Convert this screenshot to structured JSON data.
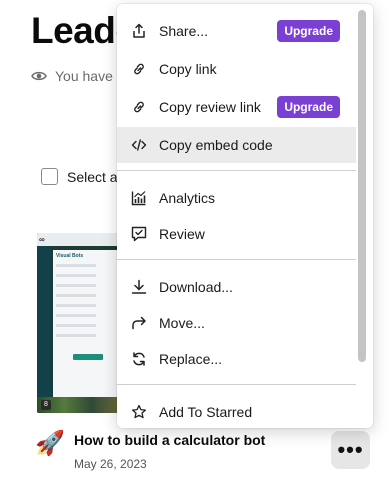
{
  "page": {
    "title": "Leado",
    "visibility_text": "You have a",
    "select_all_label": "Select a"
  },
  "card": {
    "title": "How to build a calculator bot",
    "date": "May 26, 2023",
    "emoji": "🚀",
    "more_label": "•••",
    "thumbnail": {
      "panel_title": "Visual Bots",
      "badge": "8"
    }
  },
  "menu": {
    "items": [
      {
        "label": "Share...",
        "icon": "share-icon",
        "upgrade": "Upgrade"
      },
      {
        "label": "Copy link",
        "icon": "link-icon"
      },
      {
        "label": "Copy review link",
        "icon": "link-icon",
        "upgrade": "Upgrade"
      },
      {
        "label": "Copy embed code",
        "icon": "code-icon",
        "active": true
      },
      {
        "label": "Analytics",
        "icon": "analytics-icon"
      },
      {
        "label": "Review",
        "icon": "review-icon"
      },
      {
        "label": "Download...",
        "icon": "download-icon"
      },
      {
        "label": "Move...",
        "icon": "move-arrow-icon"
      },
      {
        "label": "Replace...",
        "icon": "replace-icon"
      },
      {
        "label": "Add To Starred",
        "icon": "star-icon"
      }
    ]
  },
  "colors": {
    "upgrade_badge": "#7a3fd3",
    "active_row": "#ebebeb",
    "scrollbar": "#c4c4c4"
  }
}
